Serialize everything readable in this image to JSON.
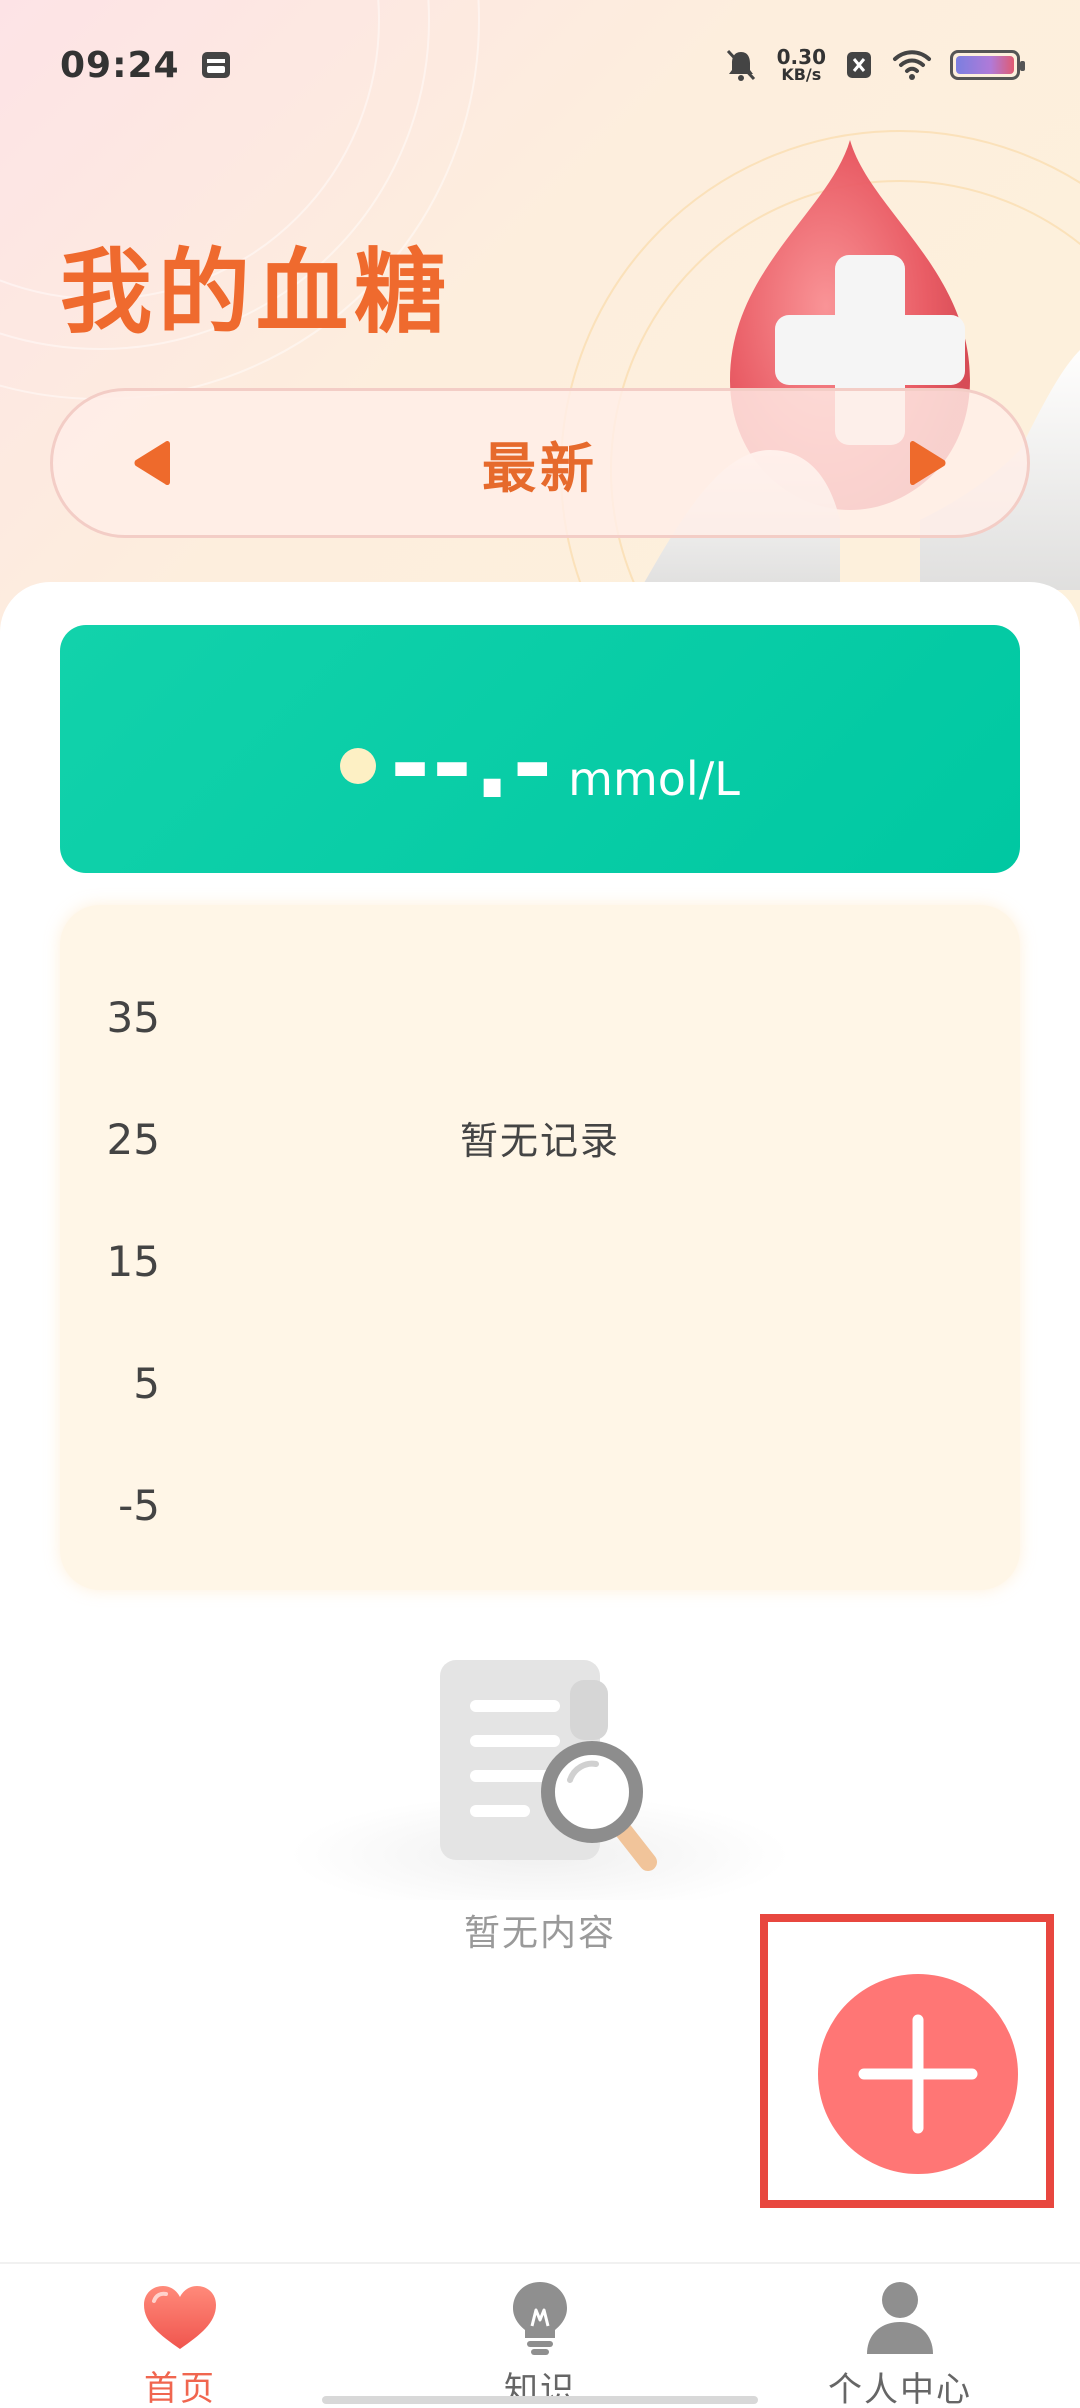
{
  "status_bar": {
    "time": "09:24",
    "net_speed_value": "0.30",
    "net_speed_unit": "KB/s"
  },
  "header": {
    "title": "我的血糖"
  },
  "period_selector": {
    "label": "最新"
  },
  "reading": {
    "value": "--.-",
    "unit": "mmol/L"
  },
  "chart_data": {
    "type": "line",
    "yticks": [
      "35",
      "25",
      "15",
      "5",
      "-5"
    ],
    "empty_text": "暂无记录"
  },
  "empty_state": {
    "text": "暂无内容"
  },
  "bottom_nav": {
    "items": [
      {
        "label": "首页"
      },
      {
        "label": "知识"
      },
      {
        "label": "个人中心"
      }
    ]
  },
  "colors": {
    "accent": "#ef6a2e",
    "reading_card": "#00c8a2",
    "fab": "#ff7675",
    "highlight": "#e8473f"
  }
}
